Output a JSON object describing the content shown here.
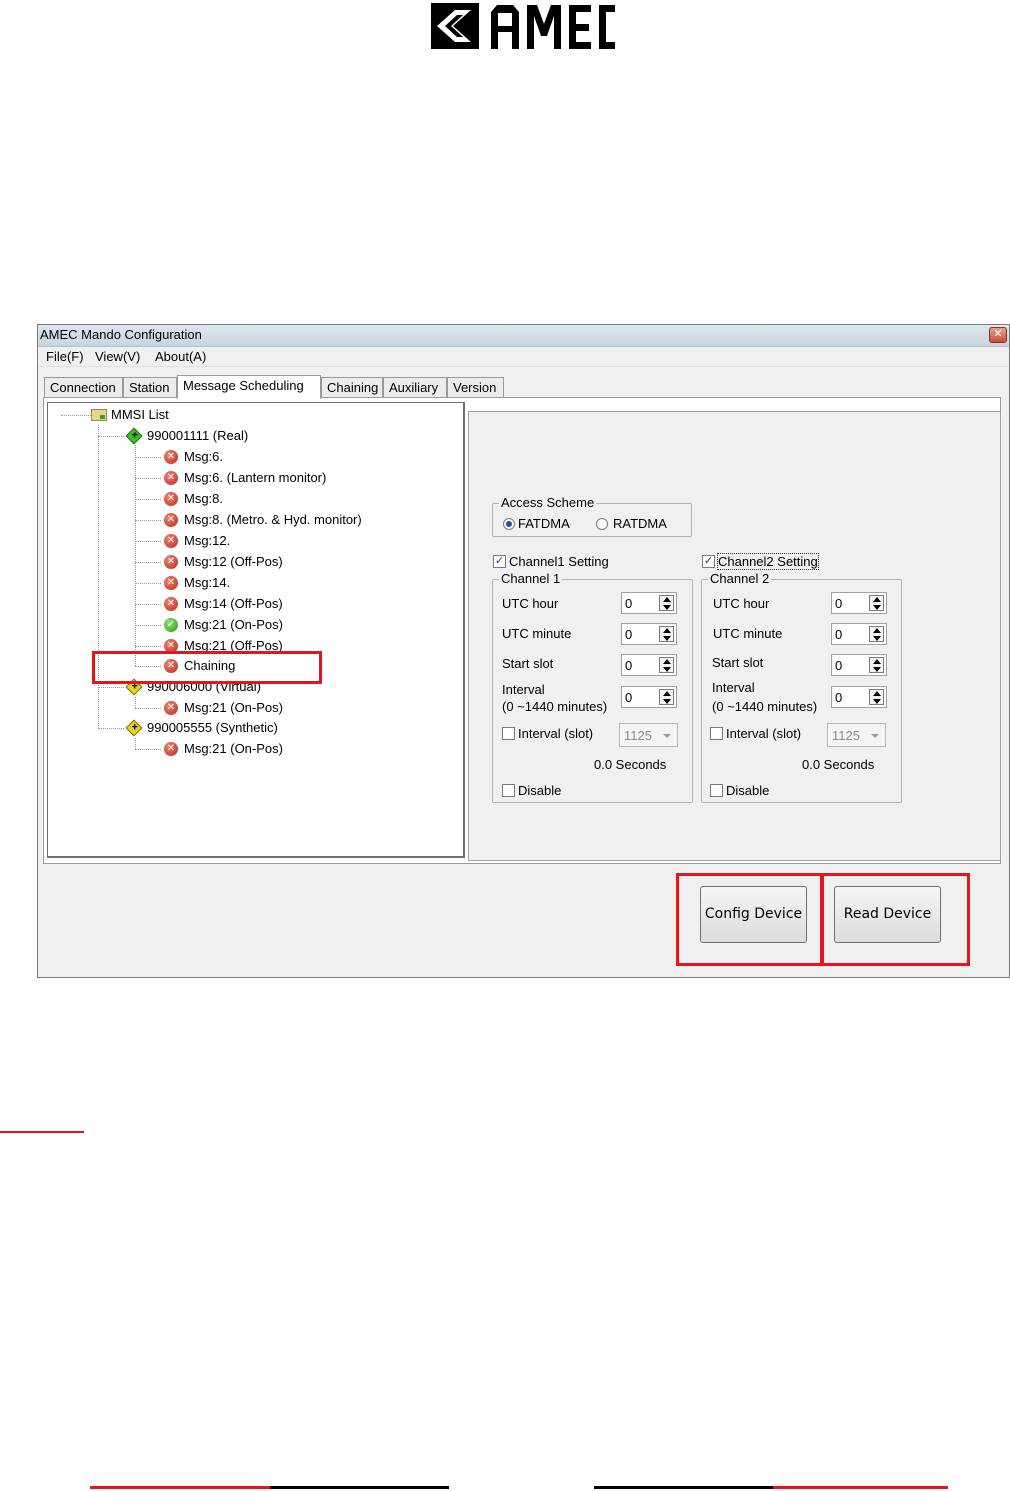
{
  "logo": {
    "text": "AMEC",
    "colors": {
      "fill": "#000000"
    }
  },
  "window": {
    "title": "AMEC Mando Configuration",
    "menu": [
      "File(F)",
      "View(V)",
      "About(A)"
    ],
    "tabs": [
      "Connection",
      "Station",
      "Message Scheduling",
      "Chaining",
      "Auxiliary",
      "Version"
    ],
    "active_tab": "Message Scheduling"
  },
  "tree": {
    "root": "MMSI List",
    "nodes": [
      {
        "label": "990001111  (Real)",
        "icon": "green-diamond-icon",
        "level": 1
      },
      {
        "label": "Msg:6.",
        "icon": "error-icon",
        "level": 2
      },
      {
        "label": "Msg:6. (Lantern monitor)",
        "icon": "error-icon",
        "level": 2
      },
      {
        "label": "Msg:8.",
        "icon": "error-icon",
        "level": 2
      },
      {
        "label": "Msg:8. (Metro. & Hyd. monitor)",
        "icon": "error-icon",
        "level": 2
      },
      {
        "label": "Msg:12.",
        "icon": "error-icon",
        "level": 2
      },
      {
        "label": "Msg:12  (Off-Pos)",
        "icon": "error-icon",
        "level": 2
      },
      {
        "label": "Msg:14.",
        "icon": "error-icon",
        "level": 2
      },
      {
        "label": "Msg:14  (Off-Pos)",
        "icon": "error-icon",
        "level": 2
      },
      {
        "label": "Msg:21  (On-Pos)",
        "icon": "ok-icon",
        "level": 2
      },
      {
        "label": "Msg:21  (Off-Pos)",
        "icon": "error-icon",
        "level": 2
      },
      {
        "label": "Chaining",
        "icon": "error-icon",
        "level": 2
      },
      {
        "label": "990006000  (Virtual)",
        "icon": "yellow-diamond-icon",
        "level": 1
      },
      {
        "label": "Msg:21  (On-Pos)",
        "icon": "error-icon",
        "level": 2
      },
      {
        "label": "990005555  (Synthetic)",
        "icon": "yellow-diamond-icon",
        "level": 1
      },
      {
        "label": "Msg:21  (On-Pos)",
        "icon": "error-icon",
        "level": 2
      }
    ]
  },
  "access_scheme": {
    "title": "Access Scheme",
    "options": [
      "FATDMA",
      "RATDMA"
    ],
    "selected": "FATDMA"
  },
  "channel1": {
    "setting_label": "Channel1 Setting",
    "setting_checked": true,
    "group_title": "Channel 1",
    "utc_hour_label": "UTC hour",
    "utc_hour": "0",
    "utc_minute_label": "UTC minute",
    "utc_minute": "0",
    "start_slot_label": "Start slot",
    "start_slot": "0",
    "interval_label": "Interval",
    "interval_range": " (0 ~1440 minutes)",
    "interval": "0",
    "interval_slot_label": "Interval (slot)",
    "interval_slot": "1125",
    "seconds": "0.0 Seconds",
    "disable_label": "Disable"
  },
  "channel2": {
    "setting_label": "Channel2 Setting",
    "setting_checked": true,
    "group_title": "Channel 2",
    "utc_hour_label": "UTC hour",
    "utc_hour": "0",
    "utc_minute_label": "UTC minute",
    "utc_minute": "0",
    "start_slot_label": "Start slot",
    "start_slot": "0",
    "interval_label": "Interval",
    "interval_range": "(0 ~1440 minutes)",
    "interval": "0",
    "interval_slot_label": "Interval (slot)",
    "interval_slot": "1125",
    "seconds": "0.0 Seconds",
    "disable_label": "Disable"
  },
  "buttons": {
    "config": "Config Device",
    "read": "Read Device"
  },
  "colors": {
    "highlight": "#e8141b",
    "footer_red": "#e8141b",
    "footer_black": "#000000"
  }
}
